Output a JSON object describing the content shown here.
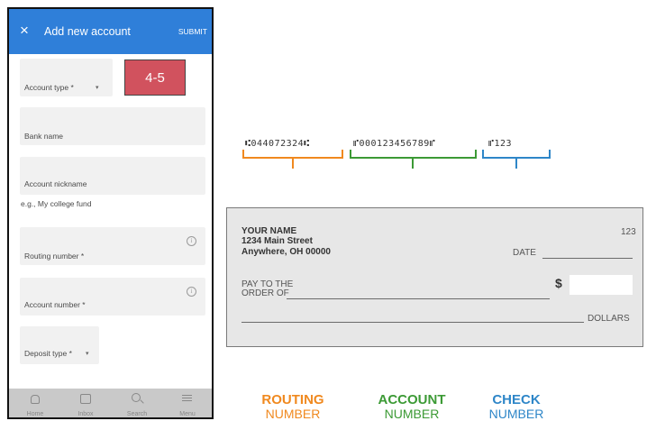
{
  "form": {
    "title": "Add new account",
    "submit": "SUBMIT",
    "close_icon": "×",
    "account_type_label": "Account type *",
    "bank_name_label": "Bank name",
    "nickname_label": "Account nickname",
    "nickname_hint": "e.g., My college fund",
    "routing_label": "Routing number *",
    "account_number_label": "Account number *",
    "deposit_type_label": "Deposit type *",
    "caret": "▾",
    "info": "i"
  },
  "badge": "4-5",
  "nav": [
    {
      "label": "Home",
      "icon": "home-icon"
    },
    {
      "label": "Inbox",
      "icon": "inbox-icon"
    },
    {
      "label": "Search",
      "icon": "search-icon"
    },
    {
      "label": "Menu",
      "icon": "menu-icon"
    }
  ],
  "check": {
    "name": "YOUR NAME",
    "street": "1234 Main Street",
    "city": "Anywhere, OH 00000",
    "number": "123",
    "date_label": "DATE",
    "pay_line1": "PAY TO THE",
    "pay_line2": "ORDER OF",
    "dollar_sign": "$",
    "dollars_label": "DOLLARS",
    "micr_routing": "⑆044072324⑆",
    "micr_account": "⑈000123456789⑈",
    "micr_check": "⑈123"
  },
  "labels": {
    "routing_top": "ROUTING",
    "routing_bottom": "NUMBER",
    "account_top": "ACCOUNT",
    "account_bottom": "NUMBER",
    "check_top": "CHECK",
    "check_bottom": "NUMBER"
  },
  "colors": {
    "appbar": "#2f7fd9",
    "badge": "#d1525e",
    "routing": "#f0891f",
    "account": "#3c9a35",
    "check": "#2e86c8"
  }
}
